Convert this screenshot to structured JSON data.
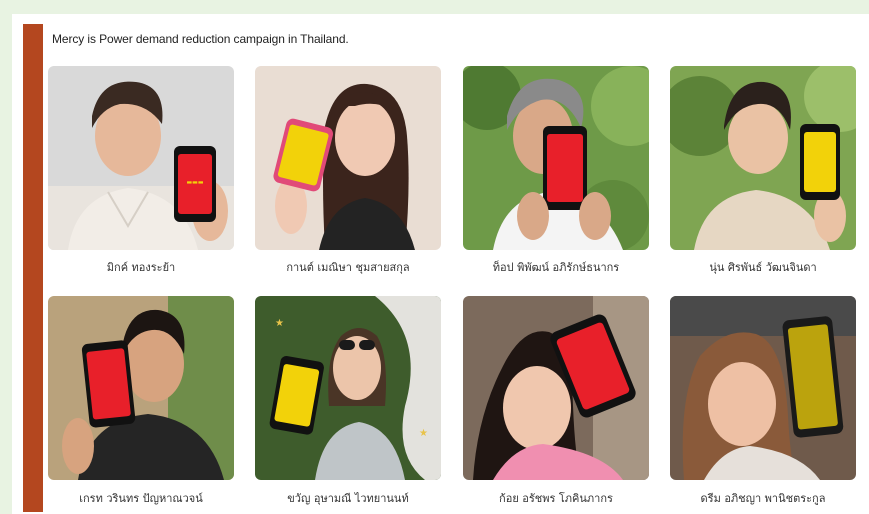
{
  "caption": "Mercy is Power demand reduction campaign in Thailand.",
  "colors": {
    "accent": "#b4471f",
    "page_bg": "#e8f3e2",
    "poster_red": "#e8202a",
    "poster_yellow": "#f2d20a"
  },
  "people": [
    {
      "name": "มิกค์ ทองระย้า",
      "phone_color": "red"
    },
    {
      "name": "กานต์ เมณิษา ชุมสายสกุล",
      "phone_color": "yellow"
    },
    {
      "name": "ท็อป พิพัฒน์ อภิรักษ์ธนากร",
      "phone_color": "red"
    },
    {
      "name": "นุ่น ศิรพันธ์ วัฒนจินดา",
      "phone_color": "yellow"
    },
    {
      "name": "เกรท วรินทร ปัญหาณวจน์",
      "phone_color": "red"
    },
    {
      "name": "ขวัญ อุษามณี ไวทยานนท์",
      "phone_color": "yellow"
    },
    {
      "name": "ก้อย อรัชพร โภคินภากร",
      "phone_color": "red"
    },
    {
      "name": "ดรีม อภิชญา พานิชตระกูล",
      "phone_color": "yellow"
    }
  ]
}
